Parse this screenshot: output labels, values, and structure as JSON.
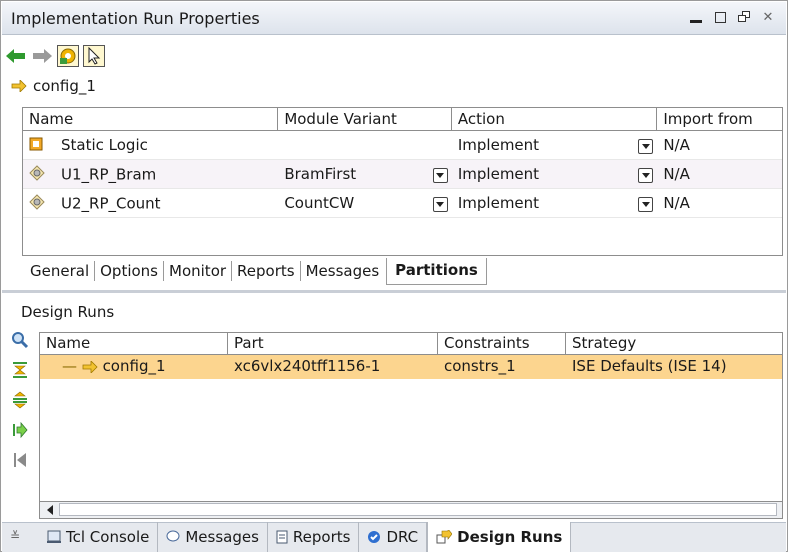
{
  "window": {
    "title": "Implementation Run Properties"
  },
  "toolbar": {
    "back_icon": "left-arrow-icon",
    "forward_icon": "right-arrow-icon",
    "config_icon": "partition-config-icon",
    "select_icon": "pointer-icon"
  },
  "run_name": "config_1",
  "partitions_table": {
    "columns": [
      "Name",
      "Module Variant",
      "Action",
      "Import from"
    ],
    "rows": [
      {
        "name": "Static Logic",
        "variant": "",
        "action": "Implement",
        "import_from": "N/A",
        "icon": "static-logic-icon"
      },
      {
        "name": "U1_RP_Bram",
        "variant": "BramFirst",
        "action": "Implement",
        "import_from": "N/A",
        "icon": "reconfig-partition-icon"
      },
      {
        "name": "U2_RP_Count",
        "variant": "CountCW",
        "action": "Implement",
        "import_from": "N/A",
        "icon": "reconfig-partition-icon"
      }
    ]
  },
  "property_tabs": [
    "General",
    "Options",
    "Monitor",
    "Reports",
    "Messages",
    "Partitions"
  ],
  "active_property_tab": "Partitions",
  "design_runs": {
    "title": "Design Runs",
    "columns": [
      "Name",
      "Part",
      "Constraints",
      "Strategy"
    ],
    "rows": [
      {
        "name": "config_1",
        "part": "xc6vlx240tff1156-1",
        "constraints": "constrs_1",
        "strategy": "ISE Defaults (ISE 14)"
      }
    ],
    "highlight_color": "#fcd58f"
  },
  "bottom_tabs": [
    {
      "label": "Tcl Console",
      "icon": "console-icon"
    },
    {
      "label": "Messages",
      "icon": "message-bubble-icon"
    },
    {
      "label": "Reports",
      "icon": "document-icon"
    },
    {
      "label": "DRC",
      "icon": "check-circle-icon"
    },
    {
      "label": "Design Runs",
      "icon": "design-runs-icon"
    }
  ],
  "active_bottom_tab": "Design Runs"
}
